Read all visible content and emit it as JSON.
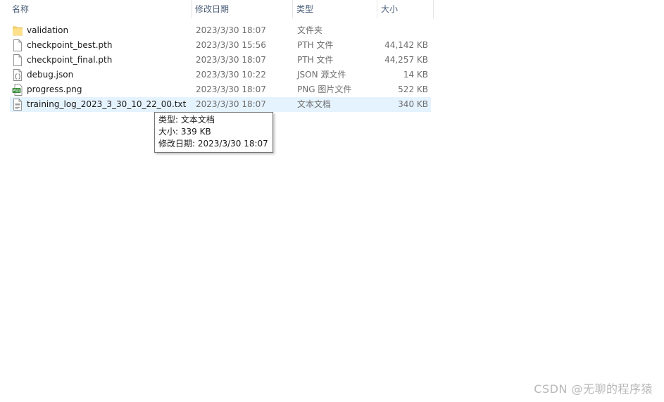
{
  "columns": {
    "name": "名称",
    "date": "修改日期",
    "type": "类型",
    "size": "大小"
  },
  "sort_indicator": "^",
  "files": [
    {
      "name": "validation",
      "date": "2023/3/30 18:07",
      "type": "文件夹",
      "size": "",
      "icon": "folder-icon"
    },
    {
      "name": "checkpoint_best.pth",
      "date": "2023/3/30 15:56",
      "type": "PTH 文件",
      "size": "44,142 KB",
      "icon": "file-icon"
    },
    {
      "name": "checkpoint_final.pth",
      "date": "2023/3/30 18:07",
      "type": "PTH 文件",
      "size": "44,257 KB",
      "icon": "file-icon"
    },
    {
      "name": "debug.json",
      "date": "2023/3/30 10:22",
      "type": "JSON 源文件",
      "size": "14 KB",
      "icon": "json-file-icon"
    },
    {
      "name": "progress.png",
      "date": "2023/3/30 18:07",
      "type": "PNG 图片文件",
      "size": "522 KB",
      "icon": "png-file-icon"
    },
    {
      "name": "training_log_2023_3_30_10_22_00.txt",
      "date": "2023/3/30 18:07",
      "type": "文本文档",
      "size": "340 KB",
      "icon": "text-file-icon"
    }
  ],
  "tooltip": {
    "type_line": "类型: 文本文档",
    "size_line": "大小: 339 KB",
    "date_line": "修改日期: 2023/3/30 18:07"
  },
  "watermark": "CSDN @无聊的程序猿"
}
